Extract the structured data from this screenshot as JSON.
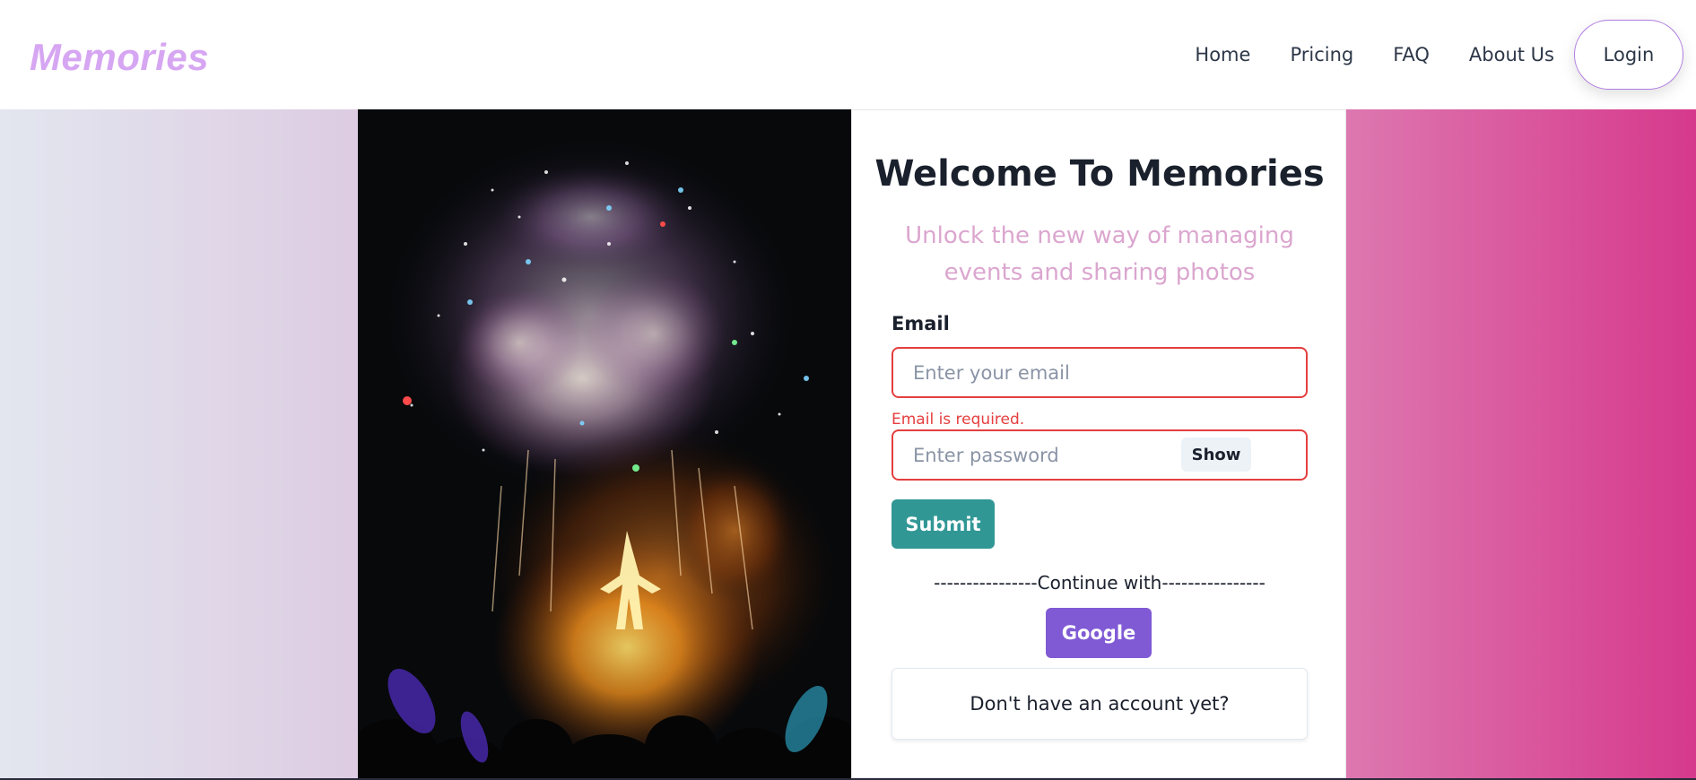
{
  "navbar": {
    "logo": "Memories",
    "links": [
      "Home",
      "Pricing",
      "FAQ",
      "About Us"
    ],
    "login": "Login"
  },
  "form": {
    "title": "Welcome To Memories",
    "subtitle": "Unlock the new way of managing events and sharing photos",
    "email_label": "Email",
    "email_placeholder": "Enter your email",
    "email_value": "",
    "email_error": "Email is required.",
    "password_placeholder": "Enter password",
    "password_value": "",
    "show_label": "Show",
    "submit_label": "Submit",
    "continue_text": "----------------Continue with----------------",
    "google_label": "Google",
    "signup_text": "Don't have an account yet?"
  },
  "colors": {
    "logo": "#d6a6f2",
    "subtitle": "#dba6cf",
    "error": "#e53e3e",
    "submit": "#319795",
    "google": "#805ad5"
  }
}
